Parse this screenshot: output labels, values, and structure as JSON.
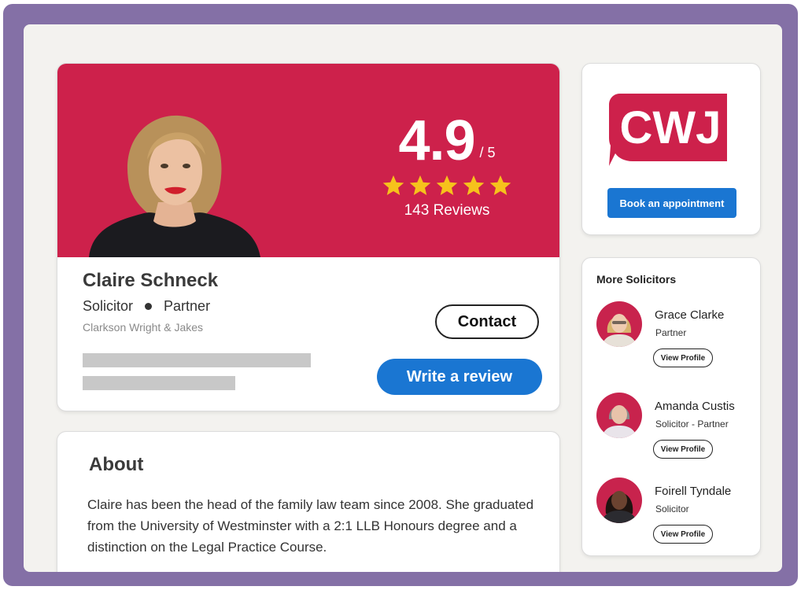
{
  "profile": {
    "rating": "4.9",
    "rating_out_of": "/ 5",
    "stars": 5,
    "reviews": "143 Reviews",
    "name": "Claire Schneck",
    "role": "Solicitor",
    "position": "Partner",
    "firm": "Clarkson Wright & Jakes",
    "contact_label": "Contact",
    "review_label": "Write a review"
  },
  "about": {
    "title": "About",
    "text": "Claire has been the head of the family law team since 2008. She graduated from the University of Westminster with a 2:1 LLB Honours degree and a distinction on the Legal Practice Course."
  },
  "sidebar": {
    "logo_text": "CWJ",
    "book_label": "Book an appointment",
    "more_title": "More Solicitors",
    "solicitors": [
      {
        "name": "Grace Clarke",
        "role": "Partner",
        "button": "View Profile"
      },
      {
        "name": "Amanda Custis",
        "role": "Solicitor - Partner",
        "button": "View Profile"
      },
      {
        "name": "Foirell Tyndale",
        "role": "Solicitor",
        "button": "View Profile"
      }
    ]
  },
  "colors": {
    "brand": "#cd214b",
    "primary_button": "#1a76d2",
    "frame": "#8470a6",
    "star": "#f6c21c"
  }
}
